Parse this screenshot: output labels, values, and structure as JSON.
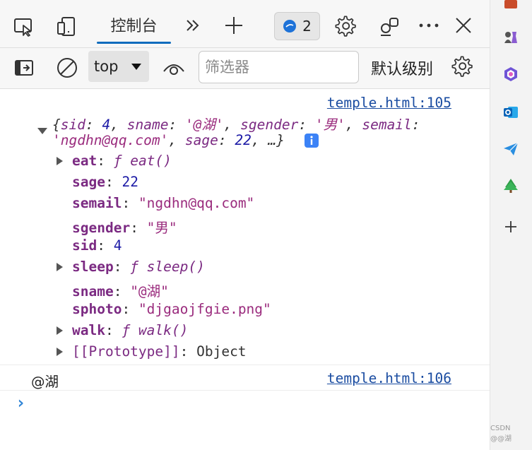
{
  "toolbar": {
    "tab_label": "控制台",
    "issues_count": "2"
  },
  "filterbar": {
    "context": "top",
    "filter_placeholder": "筛选器",
    "level_label": "默认级别"
  },
  "log1": {
    "source": "temple.html:105",
    "preview": {
      "open": "{",
      "k1": "sid",
      "v1": "4",
      "k2": "sname",
      "v2": "'@湖'",
      "k3": "sgender",
      "v3": "'男'",
      "k4": "semail",
      "v4": "'ngdhn@qq.com'",
      "k5": "sage",
      "v5": "22",
      "more": "…}",
      "colon": ":",
      "comma": ","
    },
    "properties": [
      {
        "key": "eat",
        "value": "ƒ eat()"
      },
      {
        "key": "sage",
        "value": "22"
      },
      {
        "key": "semail",
        "value": "\"ngdhn@qq.com\""
      },
      {
        "key": "sgender",
        "value": "\"男\""
      },
      {
        "key": "sid",
        "value": "4"
      },
      {
        "key": "sleep",
        "value": "ƒ sleep()"
      },
      {
        "key": "sname",
        "value": "\"@湖\""
      },
      {
        "key": "sphoto",
        "value": "\"djgaojfgie.png\""
      },
      {
        "key": "walk",
        "value": "ƒ walk()"
      },
      {
        "key": "[[Prototype]]",
        "value": "Object"
      }
    ]
  },
  "log2": {
    "text": "@湖",
    "source": "temple.html:106"
  },
  "prompt": "›",
  "watermark": "CSDN @@湖",
  "colors": {
    "accent": "#0f6cbd",
    "key": "#7b2a82",
    "number": "#1c1aa6",
    "string": "#9a2b7d",
    "link": "#1a4ca1"
  }
}
